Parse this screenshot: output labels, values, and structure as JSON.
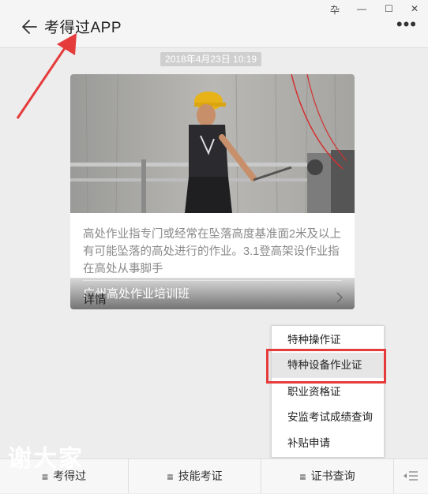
{
  "window": {
    "pin_glyph": "卆",
    "minimize_glyph": "—",
    "maximize_glyph": "☐",
    "close_glyph": "✕"
  },
  "header": {
    "title": "考得过APP",
    "more_glyph": "⋮"
  },
  "message": {
    "timestamp": "2018年4月23日 10:19",
    "card": {
      "image_caption": "广州高处作业培训班",
      "description": "高处作业指专门或经常在坠落高度基准面2米及以上有可能坠落的高处进行的作业。3.1登高架设作业指在高处从事脚手",
      "detail_label": "详情"
    }
  },
  "menu": {
    "items": [
      {
        "label": "特种操作证"
      },
      {
        "label": "特种设备作业证"
      },
      {
        "label": "职业资格证"
      },
      {
        "label": "安监考试成绩查询"
      },
      {
        "label": "补贴申请"
      }
    ]
  },
  "bottom_bar": {
    "tabs": [
      {
        "label": "考得过"
      },
      {
        "label": "技能考证"
      },
      {
        "label": "证书查询"
      }
    ]
  },
  "watermark": "谢大家",
  "colors": {
    "annotation_red": "#e53b3b",
    "background": "#ededed"
  }
}
